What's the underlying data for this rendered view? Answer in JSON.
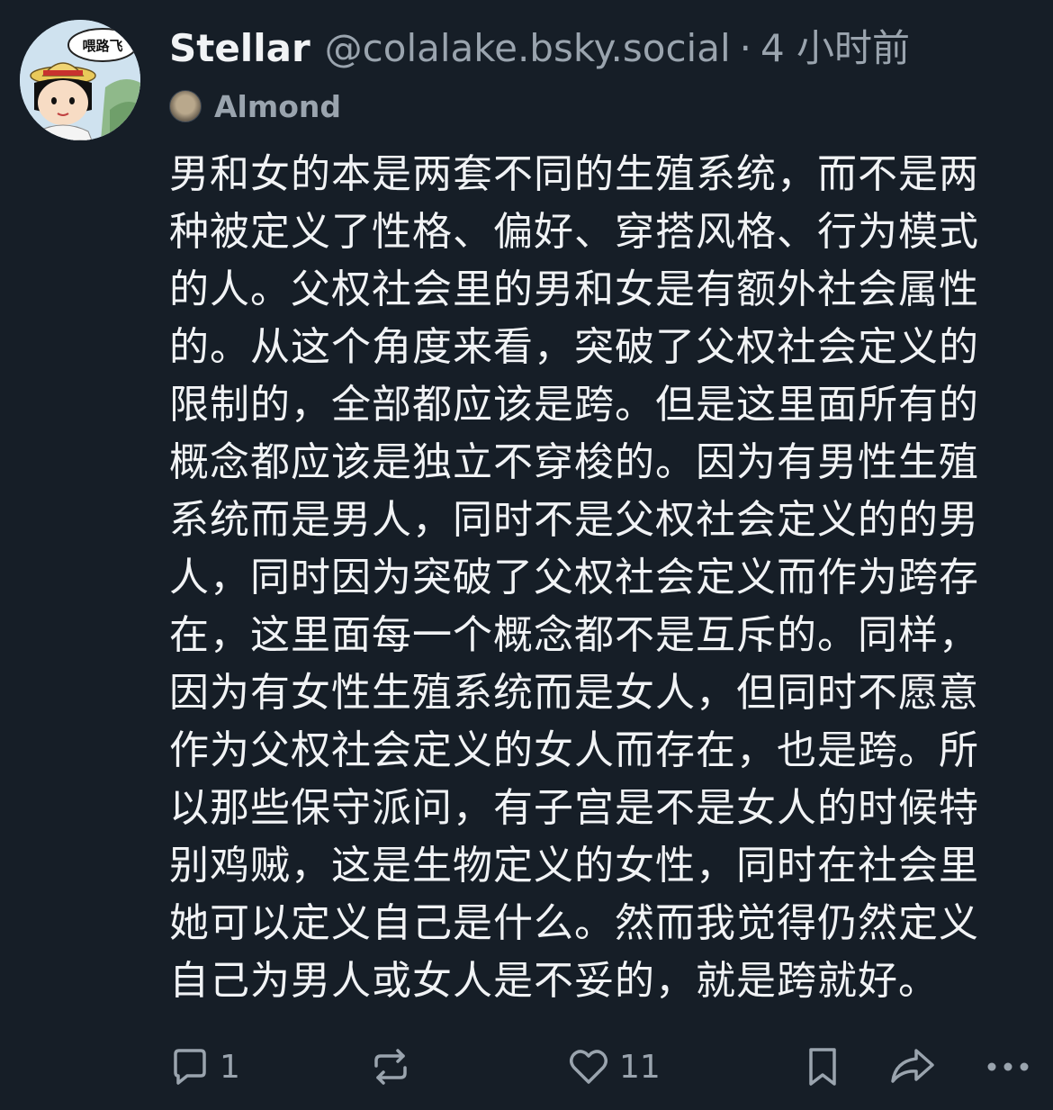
{
  "post": {
    "author": {
      "display_name": "Stellar",
      "handle": "@colalake.bsky.social",
      "avatar_caption": "喂路飞"
    },
    "separator": "·",
    "timestamp": "4 小时前",
    "label": "Almond",
    "body_lines": [
      "男和女的本是两套不同的生殖系统，而不是两",
      "种被定义了性格、偏好、穿搭风格、行为模式",
      "的人。父权社会里的男和女是有额外社会属性",
      "的。从这个角度来看，突破了父权社会定义的",
      "限制的，全部都应该是跨。但是这里面所有的",
      "概念都应该是独立不穿梭的。因为有男性生殖",
      "系统而是男人，同时不是父权社会定义的的男",
      "人，同时因为突破了父权社会定义而作为跨存",
      "在，这里面每一个概念都不是互斥的。同样，",
      "因为有女性生殖系统而是女人，但同时不愿意",
      "作为父权社会定义的女人而存在，也是跨。所",
      "以那些保守派问，有子宫是不是女人的时候特",
      "别鸡贼，这是生物定义的女性，同时在社会里",
      "她可以定义自己是什么。然而我觉得仍然定义",
      "自己为男人或女人是不妥的，就是跨就好。"
    ],
    "actions": {
      "reply_count": "1",
      "like_count": "11",
      "icons": [
        "reply-icon",
        "repost-icon",
        "like-icon",
        "bookmark-icon",
        "share-icon",
        "more-icon"
      ]
    }
  },
  "colors": {
    "background": "#161e27",
    "text": "#f1f3f5",
    "muted": "#9aa4ae"
  }
}
